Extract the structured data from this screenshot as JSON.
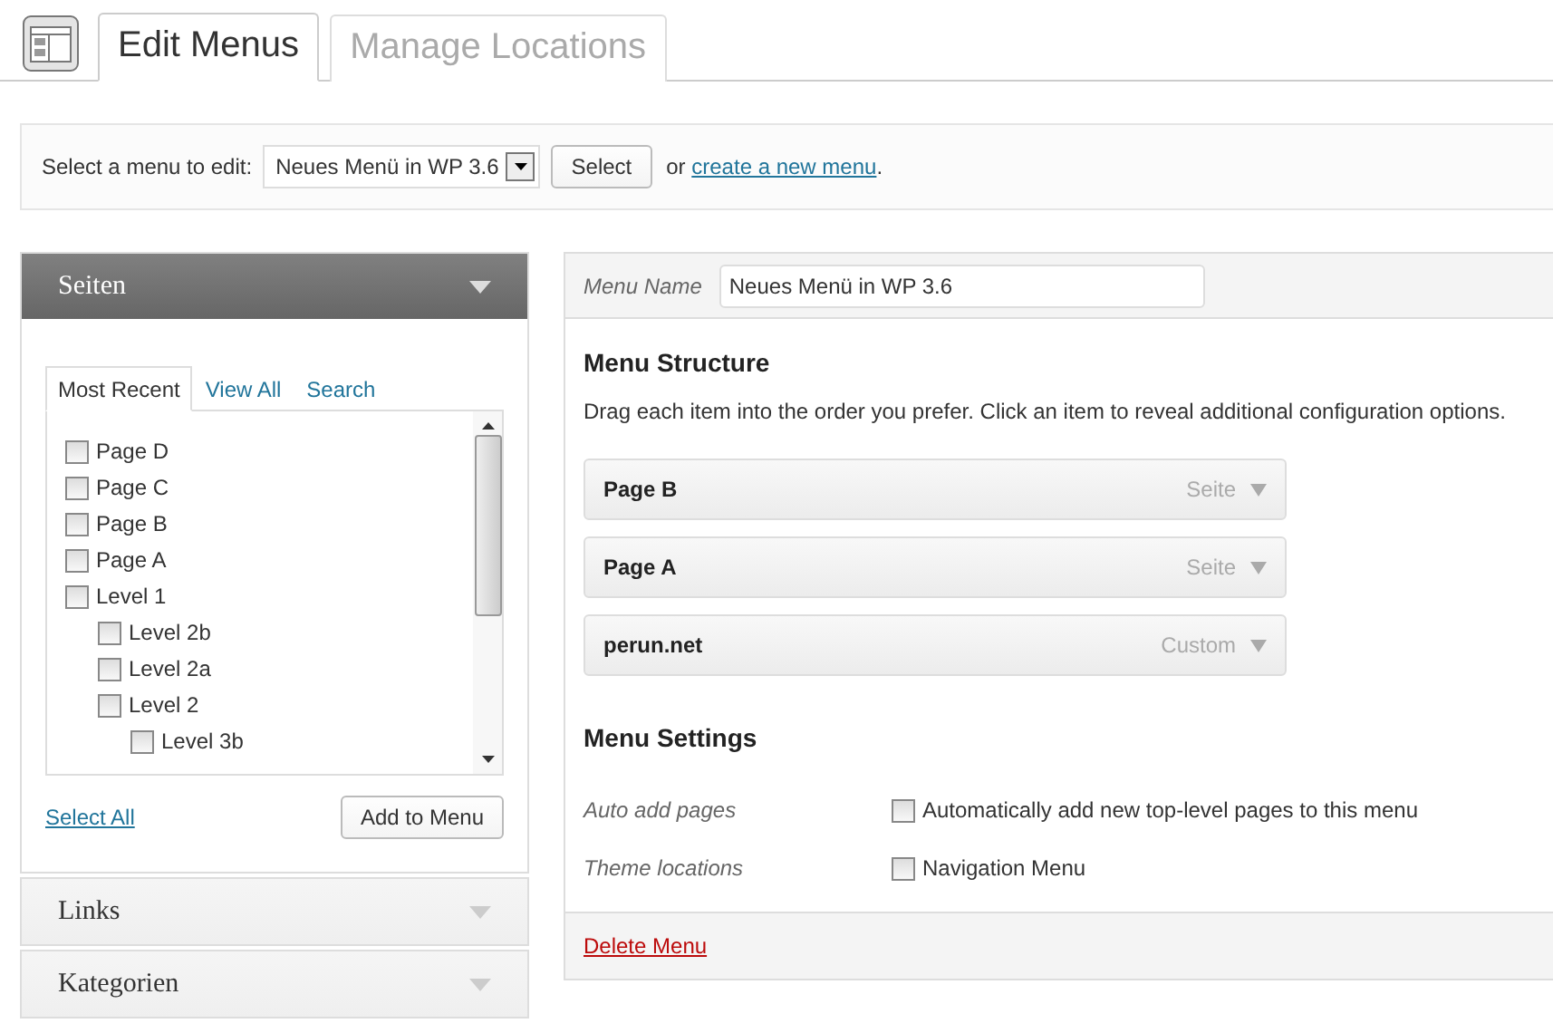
{
  "tabs": [
    {
      "label": "Edit Menus",
      "selected": true
    },
    {
      "label": "Manage Locations",
      "selected": false
    }
  ],
  "menu_select": {
    "label": "Select a menu to edit:",
    "value": "Neues Menü in WP 3.6",
    "button": "Select",
    "or_text": "or",
    "create_link": "create a new menu",
    "period": "."
  },
  "sections": [
    {
      "title": "Seiten",
      "expanded": true,
      "tabs": [
        {
          "label": "Most Recent",
          "selected": true
        },
        {
          "label": "View All",
          "selected": false
        },
        {
          "label": "Search",
          "selected": false
        }
      ],
      "pages": [
        {
          "label": "Page D",
          "checked": false
        },
        {
          "label": "Page C",
          "checked": false
        },
        {
          "label": "Page B",
          "checked": false
        },
        {
          "label": "Page A",
          "checked": false
        },
        {
          "label": "Level 1",
          "checked": false,
          "children": [
            {
              "label": "Level 2b",
              "checked": false
            },
            {
              "label": "Level 2a",
              "checked": false
            },
            {
              "label": "Level 2",
              "checked": false,
              "children": [
                {
                  "label": "Level 3b",
                  "checked": false
                }
              ]
            }
          ]
        }
      ],
      "select_all": "Select All",
      "add_button": "Add to Menu"
    },
    {
      "title": "Links",
      "expanded": false
    },
    {
      "title": "Kategorien",
      "expanded": false
    }
  ],
  "menu_name": {
    "label": "Menu Name",
    "value": "Neues Menü in WP 3.6"
  },
  "structure": {
    "title": "Menu Structure",
    "description": "Drag each item into the order you prefer. Click an item to reveal additional configuration options.",
    "items": [
      {
        "title": "Page B",
        "type": "Seite"
      },
      {
        "title": "Page A",
        "type": "Seite"
      },
      {
        "title": "perun.net",
        "type": "Custom"
      }
    ]
  },
  "settings": {
    "title": "Menu Settings",
    "rows": [
      {
        "label": "Auto add pages",
        "option": "Automatically add new top-level pages to this menu",
        "checked": false
      },
      {
        "label": "Theme locations",
        "option": "Navigation Menu",
        "checked": false
      }
    ]
  },
  "delete_link": "Delete Menu"
}
